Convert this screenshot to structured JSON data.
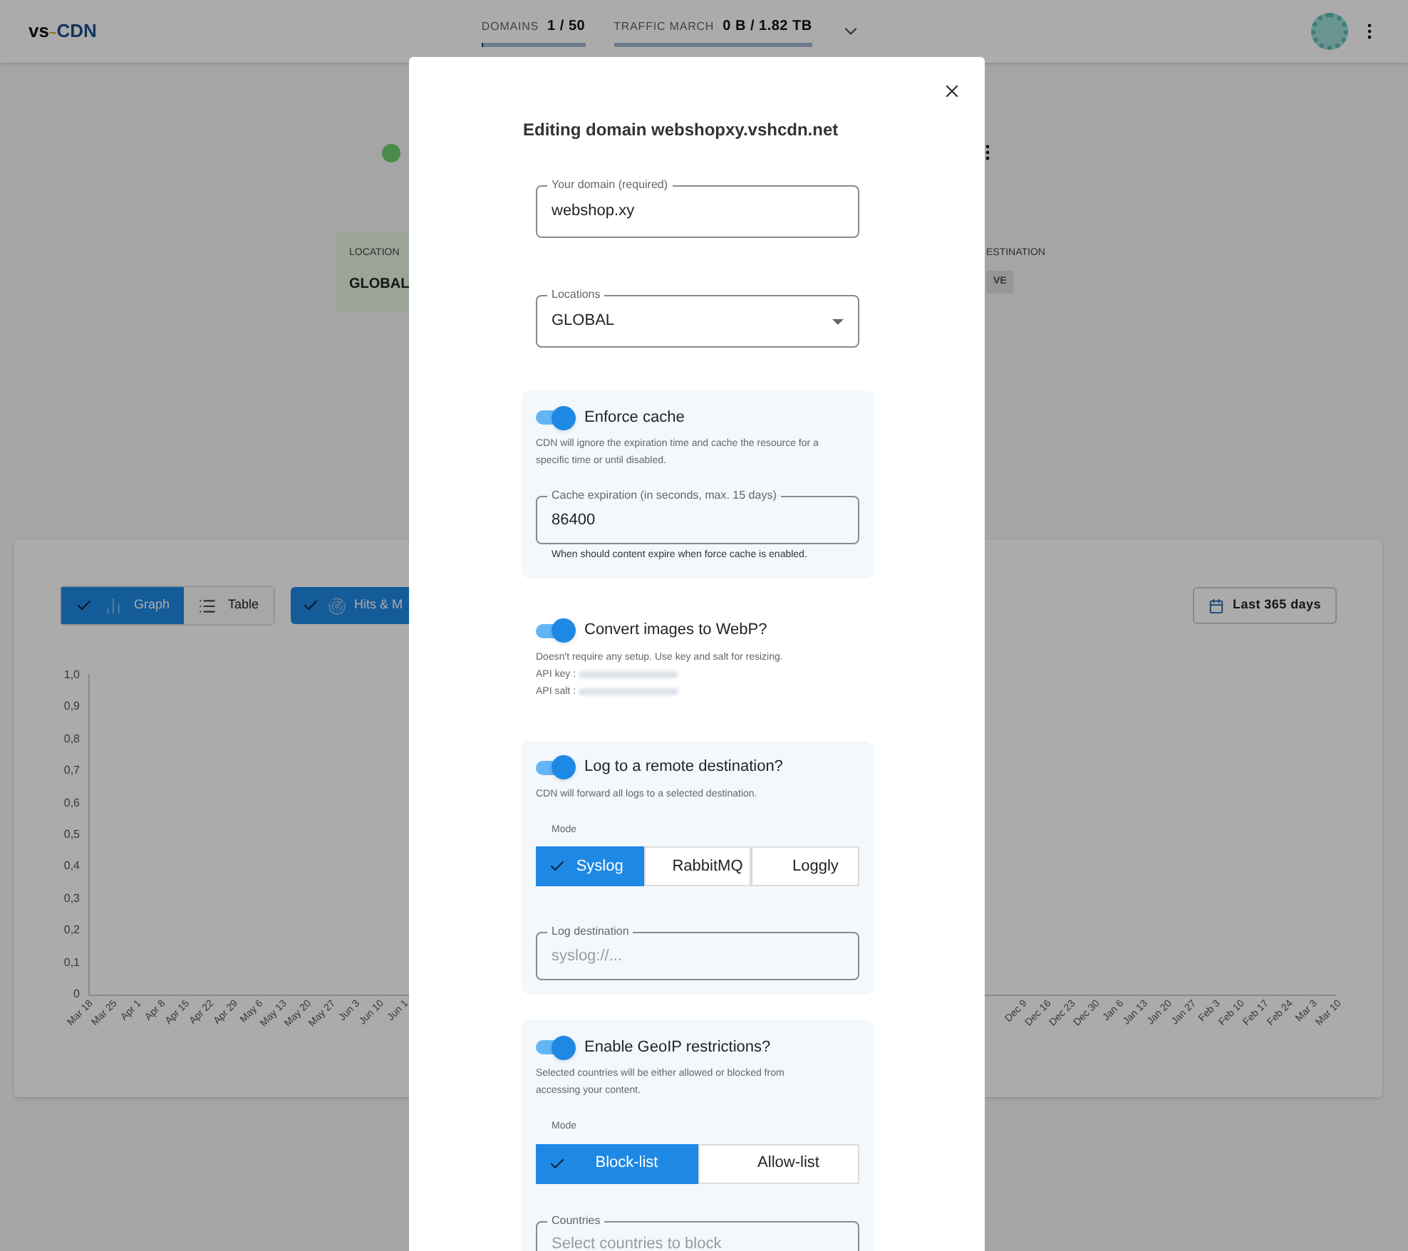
{
  "header": {
    "logo": {
      "part_1": "vs",
      "part_2": "~",
      "part_3": "CDN"
    },
    "stats": [
      {
        "label": "DOMAINS",
        "value": "1 / 50",
        "level": 0.02
      },
      {
        "label": "TRAFFIC MARCH",
        "value": "0 B / 1.82 TB",
        "level": 0
      }
    ]
  },
  "domain_row": {
    "online": true
  },
  "info_cards": [
    {
      "kind": "text",
      "label": "LOCATION",
      "value": "GLOBAL"
    },
    {
      "kind": "chip",
      "label": "ESTINATION",
      "value": "VE"
    }
  ],
  "stats_panel": {
    "view_toggle": [
      {
        "label": "Graph",
        "selected": true
      },
      {
        "label": "Table",
        "selected": false
      }
    ],
    "metric_toggle": {
      "label": "Hits & M",
      "selected": true
    },
    "range_button": "Last 365 days",
    "chart": {
      "y_ticks": [
        "1,0",
        "0,9",
        "0,8",
        "0,7",
        "0,6",
        "0,5",
        "0,4",
        "0,3",
        "0,2",
        "0,1",
        "0"
      ],
      "x_labels_left": [
        "Mar 18",
        "Mar 25",
        "Apr 1",
        "Apr 8",
        "Apr 15",
        "Apr 22",
        "Apr 29",
        "May 6",
        "May 13",
        "May 20",
        "May 27",
        "Jun 3",
        "Jun 10",
        "Jun 1"
      ],
      "x_labels_right": [
        "Dec 9",
        "Dec 16",
        "Dec 23",
        "Dec 30",
        "Jan 6",
        "Jan 13",
        "Jan 20",
        "Jan 27",
        "Feb 3",
        "Feb 10",
        "Feb 17",
        "Feb 24",
        "Mar 3",
        "Mar 10"
      ]
    }
  },
  "dialog": {
    "title": "Editing domain webshopxy.vshcdn.net",
    "domain_field": {
      "label": "Your domain (required)",
      "value": "webshop.xy"
    },
    "locations_select": {
      "label": "Locations",
      "value": "GLOBAL"
    },
    "sections": [
      {
        "kind": "cache",
        "on": true,
        "title": "Enforce cache",
        "description": "CDN will ignore the expiration time and cache the resource for a specific time or until disabled.",
        "field": {
          "label": "Cache expiration (in seconds, max. 15 days)",
          "value": "86400"
        },
        "helper": "When should content expire when force cache is enabled."
      },
      {
        "kind": "webp",
        "on": true,
        "title": "Convert images to WebP?",
        "description": "Doesn't require any setup. Use key and salt for resizing.",
        "secrets": [
          "API key :",
          "API salt :"
        ]
      },
      {
        "kind": "log",
        "on": true,
        "title": "Log to a remote destination?",
        "description": "CDN will forward all logs to a selected destination.",
        "mode_label": "Mode",
        "modes": [
          {
            "label": "Syslog",
            "selected": true
          },
          {
            "label": "RabbitMQ",
            "selected": false
          },
          {
            "label": "Loggly",
            "selected": false
          }
        ],
        "field": {
          "label": "Log destination",
          "placeholder": "syslog://..."
        }
      },
      {
        "kind": "geoip",
        "on": true,
        "title": "Enable GeoIP restrictions?",
        "description": "Selected countries will be either allowed or blocked from accessing your content.",
        "mode_label": "Mode",
        "modes": [
          {
            "label": "Block-list",
            "selected": true
          },
          {
            "label": "Allow-list",
            "selected": false
          }
        ],
        "field": {
          "label": "Countries",
          "placeholder": "Select countries to block"
        }
      }
    ]
  }
}
